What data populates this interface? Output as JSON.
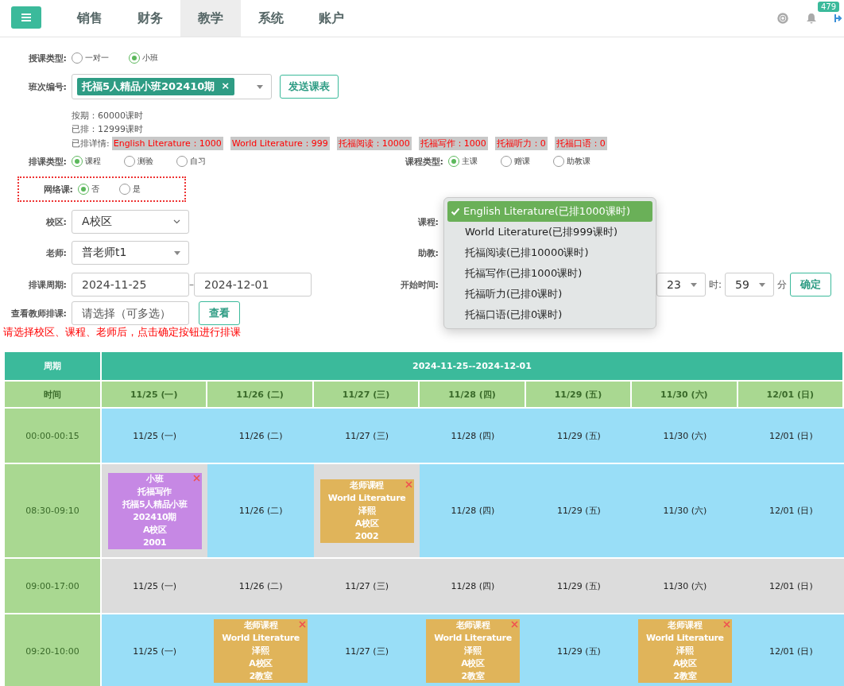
{
  "nav": {
    "items": [
      {
        "label": "销售",
        "selected": false
      },
      {
        "label": "财务",
        "selected": false
      },
      {
        "label": "教学",
        "selected": true
      },
      {
        "label": "系统",
        "selected": false
      },
      {
        "label": "账户",
        "selected": false
      }
    ],
    "notification_count": "479"
  },
  "form": {
    "teaching_type": {
      "label": "授课类型:",
      "options": [
        {
          "label": "一对一",
          "selected": false
        },
        {
          "label": "小班",
          "selected": true
        }
      ]
    },
    "class_number": {
      "label": "班次编号:",
      "tag": "托福5人精品小班202410期",
      "tag_remove": "×",
      "button": "发送课表"
    },
    "stats": [
      "按期：60000课时",
      "已排：12999课时"
    ],
    "details": {
      "label": "已排详情:",
      "chips": [
        "English Literature：1000",
        "World Literature：999",
        "托福阅读：10000",
        "托福写作：1000",
        "托福听力：0",
        "托福口语：0"
      ]
    },
    "schedule_type": {
      "label": "排课类型:",
      "options": [
        {
          "label": "课程",
          "selected": true
        },
        {
          "label": "测验",
          "selected": false
        },
        {
          "label": "自习",
          "selected": false
        }
      ]
    },
    "course_type": {
      "label": "课程类型:",
      "options": [
        {
          "label": "主课",
          "selected": true
        },
        {
          "label": "赠课",
          "selected": false
        },
        {
          "label": "助教课",
          "selected": false
        }
      ]
    },
    "online": {
      "label": "网络课:",
      "options": [
        {
          "label": "否",
          "selected": true
        },
        {
          "label": "是",
          "selected": false
        }
      ]
    },
    "campus": {
      "label": "校区:",
      "value": "A校区"
    },
    "teacher": {
      "label": "老师:",
      "value": "普老师t1"
    },
    "period": {
      "label": "排课周期:",
      "start": "2024-11-25",
      "separator": "–",
      "end": "2024-12-01"
    },
    "view_teacher": {
      "label": "查看教师排课:",
      "placeholder": "请选择（可多选）",
      "button": "查看"
    },
    "hint": "请选择校区、课程、老师后，点击确定按钮进行排课",
    "course": {
      "label": "课程:",
      "options": [
        {
          "label": "English Literature(已排1000课时)",
          "selected": true
        },
        {
          "label": "World Literature(已排999课时)",
          "selected": false
        },
        {
          "label": "托福阅读(已排10000课时)",
          "selected": false
        },
        {
          "label": "托福写作(已排1000课时)",
          "selected": false
        },
        {
          "label": "托福听力(已排0课时)",
          "selected": false
        },
        {
          "label": "托福口语(已排0课时)",
          "selected": false
        }
      ]
    },
    "assistant": {
      "label": "助教:"
    },
    "start_time": {
      "label": "开始时间:",
      "hour": "23",
      "hour_unit": "时:",
      "minute": "59",
      "minute_unit": "分",
      "button": "确定"
    }
  },
  "table": {
    "corner_top": "周期",
    "range": "2024-11-25--2024-12-01",
    "corner_bottom": "时间",
    "days": [
      "11/25 (一)",
      "11/26 (二)",
      "11/27 (三)",
      "11/28 (四)",
      "11/29 (五)",
      "11/30 (六)",
      "12/01 (日)"
    ],
    "rows": [
      {
        "time": "00:00-00:15",
        "cells": [
          {
            "kind": "date",
            "busy": false,
            "text": "11/25 (一)"
          },
          {
            "kind": "date",
            "busy": false,
            "text": "11/26 (二)"
          },
          {
            "kind": "date",
            "busy": false,
            "text": "11/27 (三)"
          },
          {
            "kind": "date",
            "busy": false,
            "text": "11/28 (四)"
          },
          {
            "kind": "date",
            "busy": false,
            "text": "11/29 (五)"
          },
          {
            "kind": "date",
            "busy": false,
            "text": "11/30 (六)"
          },
          {
            "kind": "date",
            "busy": false,
            "text": "12/01 (日)"
          }
        ]
      },
      {
        "time": "08:30-09:10",
        "cells": [
          {
            "kind": "event",
            "busy": true,
            "color": "#c688e4",
            "lines": [
              "小班",
              "托福写作",
              "托福5人精品小班",
              "202410期",
              "A校区",
              "2001"
            ]
          },
          {
            "kind": "date",
            "busy": false,
            "text": "11/26 (二)"
          },
          {
            "kind": "event",
            "busy": true,
            "color": "#e0b45a",
            "lines": [
              "老师课程",
              "World Literature",
              "泽熙",
              "A校区",
              "2002"
            ]
          },
          {
            "kind": "date",
            "busy": false,
            "text": "11/28 (四)"
          },
          {
            "kind": "date",
            "busy": false,
            "text": "11/29 (五)"
          },
          {
            "kind": "date",
            "busy": false,
            "text": "11/30 (六)"
          },
          {
            "kind": "date",
            "busy": false,
            "text": "12/01 (日)"
          }
        ]
      },
      {
        "time": "09:00-17:00",
        "cells": [
          {
            "kind": "date",
            "busy": true,
            "text": "11/25 (一)"
          },
          {
            "kind": "date",
            "busy": true,
            "text": "11/26 (二)"
          },
          {
            "kind": "date",
            "busy": true,
            "text": "11/27 (三)"
          },
          {
            "kind": "date",
            "busy": true,
            "text": "11/28 (四)"
          },
          {
            "kind": "date",
            "busy": true,
            "text": "11/29 (五)"
          },
          {
            "kind": "date",
            "busy": true,
            "text": "11/30 (六)"
          },
          {
            "kind": "date",
            "busy": true,
            "text": "12/01 (日)"
          }
        ]
      },
      {
        "time": "09:20-10:00",
        "cells": [
          {
            "kind": "date",
            "busy": false,
            "text": "11/25 (一)"
          },
          {
            "kind": "event",
            "busy": false,
            "color": "#e0b45a",
            "lines": [
              "老师课程",
              "World Literature",
              "泽熙",
              "A校区",
              "2教室"
            ]
          },
          {
            "kind": "date",
            "busy": false,
            "text": "11/27 (三)"
          },
          {
            "kind": "event",
            "busy": false,
            "color": "#e0b45a",
            "lines": [
              "老师课程",
              "World Literature",
              "泽熙",
              "A校区",
              "2教室"
            ]
          },
          {
            "kind": "date",
            "busy": false,
            "text": "11/29 (五)"
          },
          {
            "kind": "event",
            "busy": false,
            "color": "#e0b45a",
            "lines": [
              "老师课程",
              "World Literature",
              "泽熙",
              "A校区",
              "2教室"
            ]
          },
          {
            "kind": "date",
            "busy": false,
            "text": "12/01 (日)"
          }
        ]
      }
    ]
  }
}
